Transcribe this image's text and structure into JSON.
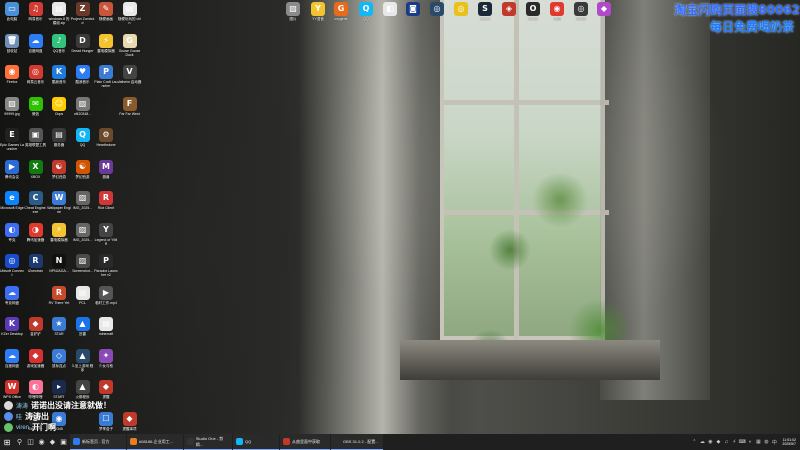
{
  "overlay": {
    "line1": "淘宝闪购页面搜80062",
    "line2": "每日免费喝奶茶"
  },
  "desktop": {
    "left_icons": [
      {
        "label": "此电脑",
        "glyph": "▭",
        "color": "#4a90d9"
      },
      {
        "label": "网易音乐",
        "glyph": "♫",
        "color": "#d33a31"
      },
      {
        "label": "windows.8 的模组.zip",
        "glyph": "▤",
        "color": "#e8e8e8"
      },
      {
        "label": "Project Zomboid",
        "glyph": "Z",
        "color": "#6b3a2a"
      },
      {
        "label": "随便画画",
        "glyph": "✎",
        "color": "#c9553a"
      },
      {
        "label": "随便玩玩的 chin",
        "glyph": "▤",
        "color": "#e8e8e8"
      },
      {
        "label": "回收站",
        "glyph": "🗑",
        "color": "#6f8fb5"
      },
      {
        "label": "百度网盘",
        "glyph": "☁",
        "color": "#2d7cf6"
      },
      {
        "label": "QQ音乐",
        "glyph": "♪",
        "color": "#31c27c"
      },
      {
        "label": "Dread Hunger",
        "glyph": "D",
        "color": "#3a3a3a"
      },
      {
        "label": "雷电模拟器",
        "glyph": "⚡",
        "color": "#f4c430"
      },
      {
        "label": "Goose Goose Duck",
        "glyph": "G",
        "color": "#e8d8b0"
      },
      {
        "label": "Firefox",
        "glyph": "◉",
        "color": "#ff7139"
      },
      {
        "label": "网易云音乐",
        "glyph": "◎",
        "color": "#d33a31"
      },
      {
        "label": "酷我音乐",
        "glyph": "K",
        "color": "#1f7ae0"
      },
      {
        "label": "酷我音乐",
        "glyph": "♥",
        "color": "#2d7cf6"
      },
      {
        "label": "Plain Craft Launcher",
        "glyph": "P",
        "color": "#3a7bd5"
      },
      {
        "label": "Valheim 启动器",
        "glyph": "V",
        "color": "#444"
      },
      {
        "label": "99999.jpg",
        "glyph": "▨",
        "color": "#888"
      },
      {
        "label": "微信",
        "glyph": "✉",
        "color": "#2dc100"
      },
      {
        "label": "Oops",
        "glyph": "☺",
        "color": "#ffcc00"
      },
      {
        "label": "cf420348...",
        "glyph": "▨",
        "color": "#777"
      },
      {
        "label": "",
        "glyph": "",
        "color": ""
      },
      {
        "label": "Far Far West",
        "glyph": "F",
        "color": "#8a5a2a"
      },
      {
        "label": "Epic Games Launcher",
        "glyph": "E",
        "color": "#222"
      },
      {
        "label": "英雄联盟工具",
        "glyph": "▣",
        "color": "#555"
      },
      {
        "label": "服务器",
        "glyph": "▤",
        "color": "#3a3a3a"
      },
      {
        "label": "QQ",
        "glyph": "Q",
        "color": "#12b7f5"
      },
      {
        "label": "Hearthstone",
        "glyph": "⚙",
        "color": "#6a4a2a"
      },
      {
        "label": "",
        "glyph": "",
        "color": ""
      },
      {
        "label": "腾讯会议",
        "glyph": "▶",
        "color": "#2a6ad9"
      },
      {
        "label": "XBOX",
        "glyph": "X",
        "color": "#107c10"
      },
      {
        "label": "梦幻西游",
        "glyph": "☯",
        "color": "#c0392b"
      },
      {
        "label": "梦幻西游",
        "glyph": "☯",
        "color": "#d35400"
      },
      {
        "label": "魔兽",
        "glyph": "M",
        "color": "#6a3a9a"
      },
      {
        "label": "",
        "glyph": "",
        "color": ""
      },
      {
        "label": "Microsoft Edge",
        "glyph": "e",
        "color": "#0a84ff"
      },
      {
        "label": "Cheat Engine.exe",
        "glyph": "C",
        "color": "#2a5c8a"
      },
      {
        "label": "Wallpaper Engine",
        "glyph": "W",
        "color": "#3a7bd5"
      },
      {
        "label": "IMG_2025...",
        "glyph": "▨",
        "color": "#666"
      },
      {
        "label": "Riot Client",
        "glyph": "R",
        "color": "#d13639"
      },
      {
        "label": "",
        "glyph": "",
        "color": ""
      },
      {
        "label": "夸克",
        "glyph": "◐",
        "color": "#3d6df2"
      },
      {
        "label": "腾讯加速器",
        "glyph": "◑",
        "color": "#e03a2f"
      },
      {
        "label": "雷电模拟器",
        "glyph": "⚡",
        "color": "#f4c430"
      },
      {
        "label": "IMG_2025...",
        "glyph": "▨",
        "color": "#666"
      },
      {
        "label": "Legend of YMIR",
        "glyph": "Y",
        "color": "#444"
      },
      {
        "label": "",
        "glyph": "",
        "color": ""
      },
      {
        "label": "Ubisoft Connect",
        "glyph": "◎",
        "color": "#1a4dcc"
      },
      {
        "label": "iZneotran",
        "glyph": "R",
        "color": "#1c3a70"
      },
      {
        "label": "NPNJAGA...",
        "glyph": "N",
        "color": "#111"
      },
      {
        "label": "Screenshot...",
        "glyph": "▨",
        "color": "#4a4a4a"
      },
      {
        "label": "Paradox Launcher v2",
        "glyph": "P",
        "color": "#2a2a2a"
      },
      {
        "label": "",
        "glyph": "",
        "color": ""
      },
      {
        "label": "夸克网盘",
        "glyph": "☁",
        "color": "#3d6df2"
      },
      {
        "label": "",
        "glyph": "",
        "color": ""
      },
      {
        "label": "RV There Yet",
        "glyph": "R",
        "color": "#c74a2a"
      },
      {
        "label": "PCL",
        "glyph": "▤",
        "color": "#e8e8e8"
      },
      {
        "label": "临时工作.mp4",
        "glyph": "▶",
        "color": "#555"
      },
      {
        "label": "",
        "glyph": "",
        "color": ""
      },
      {
        "label": "KZer Desktop",
        "glyph": "K",
        "color": "#5a3ab5"
      },
      {
        "label": "金铲铲",
        "glyph": "◆",
        "color": "#c0392b"
      },
      {
        "label": "STAR",
        "glyph": "★",
        "color": "#3a7bd5"
      },
      {
        "label": "迅雷",
        "glyph": "▲",
        "color": "#1a73e8"
      },
      {
        "label": "minecraft",
        "glyph": "▤",
        "color": "#e8e8e8"
      },
      {
        "label": "",
        "glyph": "",
        "color": ""
      },
      {
        "label": "百度网盘",
        "glyph": "☁",
        "color": "#2d7cf6"
      },
      {
        "label": "游戏加速器",
        "glyph": "◆",
        "color": "#d63030"
      },
      {
        "label": "鼠标连点",
        "glyph": "◇",
        "color": "#3a7bd5"
      },
      {
        "label": "3-坐上游戏 程序",
        "glyph": "▲",
        "color": "#2a4a6a"
      },
      {
        "label": "少女与枪",
        "glyph": "✦",
        "color": "#8a4ab5"
      },
      {
        "label": "",
        "glyph": "",
        "color": ""
      },
      {
        "label": "WPS Office",
        "glyph": "W",
        "color": "#d0302b"
      },
      {
        "label": "哔哩哔哩",
        "glyph": "◐",
        "color": "#fb7299"
      },
      {
        "label": "START",
        "glyph": "▸",
        "color": "#1a2a4a"
      },
      {
        "label": "火箭程序",
        "glyph": "▲",
        "color": "#444"
      },
      {
        "label": "提醒",
        "glyph": "◆",
        "color": "#c0392b"
      },
      {
        "label": "",
        "glyph": "",
        "color": ""
      },
      {
        "label": "",
        "glyph": "",
        "color": ""
      },
      {
        "label": "Steam++",
        "glyph": "S",
        "color": "#2a2a2a"
      },
      {
        "label": "2345",
        "glyph": "◉",
        "color": "#3a7bd5"
      },
      {
        "label": "",
        "glyph": "",
        "color": ""
      },
      {
        "label": "梦享盒子",
        "glyph": "☐",
        "color": "#3a7bd5"
      },
      {
        "label": "提醒事项",
        "glyph": "◆",
        "color": "#c0392b"
      }
    ],
    "top_icons": [
      {
        "label": "图片",
        "glyph": "▨",
        "color": "#8a8a8a"
      },
      {
        "label": "YY语音",
        "glyph": "Y",
        "color": "#f4c430"
      },
      {
        "label": "oxygene",
        "glyph": "G",
        "color": "#e86a1a"
      },
      {
        "label": "QQ",
        "glyph": "Q",
        "color": "#12b7f5"
      },
      {
        "label": "",
        "glyph": "◧",
        "color": "#e8e8e8"
      },
      {
        "label": "",
        "glyph": "◙",
        "color": "#1a3a8a"
      },
      {
        "label": "",
        "glyph": "◎",
        "color": "#2a4a6a"
      },
      {
        "label": "",
        "glyph": "◎",
        "color": "#e8c21a"
      },
      {
        "label": "Steam",
        "glyph": "S",
        "color": "#1b2838"
      },
      {
        "label": "",
        "glyph": "◈",
        "color": "#c0392b"
      },
      {
        "label": "Studio",
        "glyph": "O",
        "color": "#2a2a2a"
      },
      {
        "label": "火绒",
        "glyph": "◉",
        "color": "#e03a2f"
      },
      {
        "label": "Studio",
        "glyph": "◎",
        "color": "#3a3a3a"
      },
      {
        "label": "",
        "glyph": "◆",
        "color": "#b04ac9"
      }
    ]
  },
  "chat": [
    {
      "name": "涛涛",
      "msg": "诺诺出没请注意就做！",
      "color": "#d9d9d9"
    },
    {
      "name": "哇",
      "msg": "涛涛出",
      "color": "#5a8dee"
    },
    {
      "name": "viren",
      "msg": "开门啊",
      "color": "#66c36a"
    }
  ],
  "taskbar": {
    "start_glyph": "⊞",
    "search_glyph": "⚲",
    "pinned": [
      "◫",
      "◉",
      "◆",
      "▣"
    ],
    "apps": [
      {
        "label": "新标签页 - 官方",
        "color": "#2d7cf6"
      },
      {
        "label": "#08186-企业用工...",
        "color": "#e67e22"
      },
      {
        "label": "Studio One - 剪辑...",
        "color": "#333"
      },
      {
        "label": "QQ",
        "color": "#12b7f5"
      },
      {
        "label": "从曲里面中获取",
        "color": "#c0392b"
      },
      {
        "label": "OBS 31.0.2 - 配置...",
        "color": "#2a2a2a"
      }
    ],
    "tray": [
      "⌃",
      "☁",
      "◉",
      "◆",
      "♫",
      "⚡",
      "⌨",
      "◐",
      "▦",
      "◍",
      "中"
    ],
    "time": "11:51:02",
    "date": "2025/5/7"
  },
  "colors": {
    "overlay_text": "#2c6cff",
    "taskbar_bg": "#1f1f1f",
    "active_underline": "#7aa7ff"
  }
}
